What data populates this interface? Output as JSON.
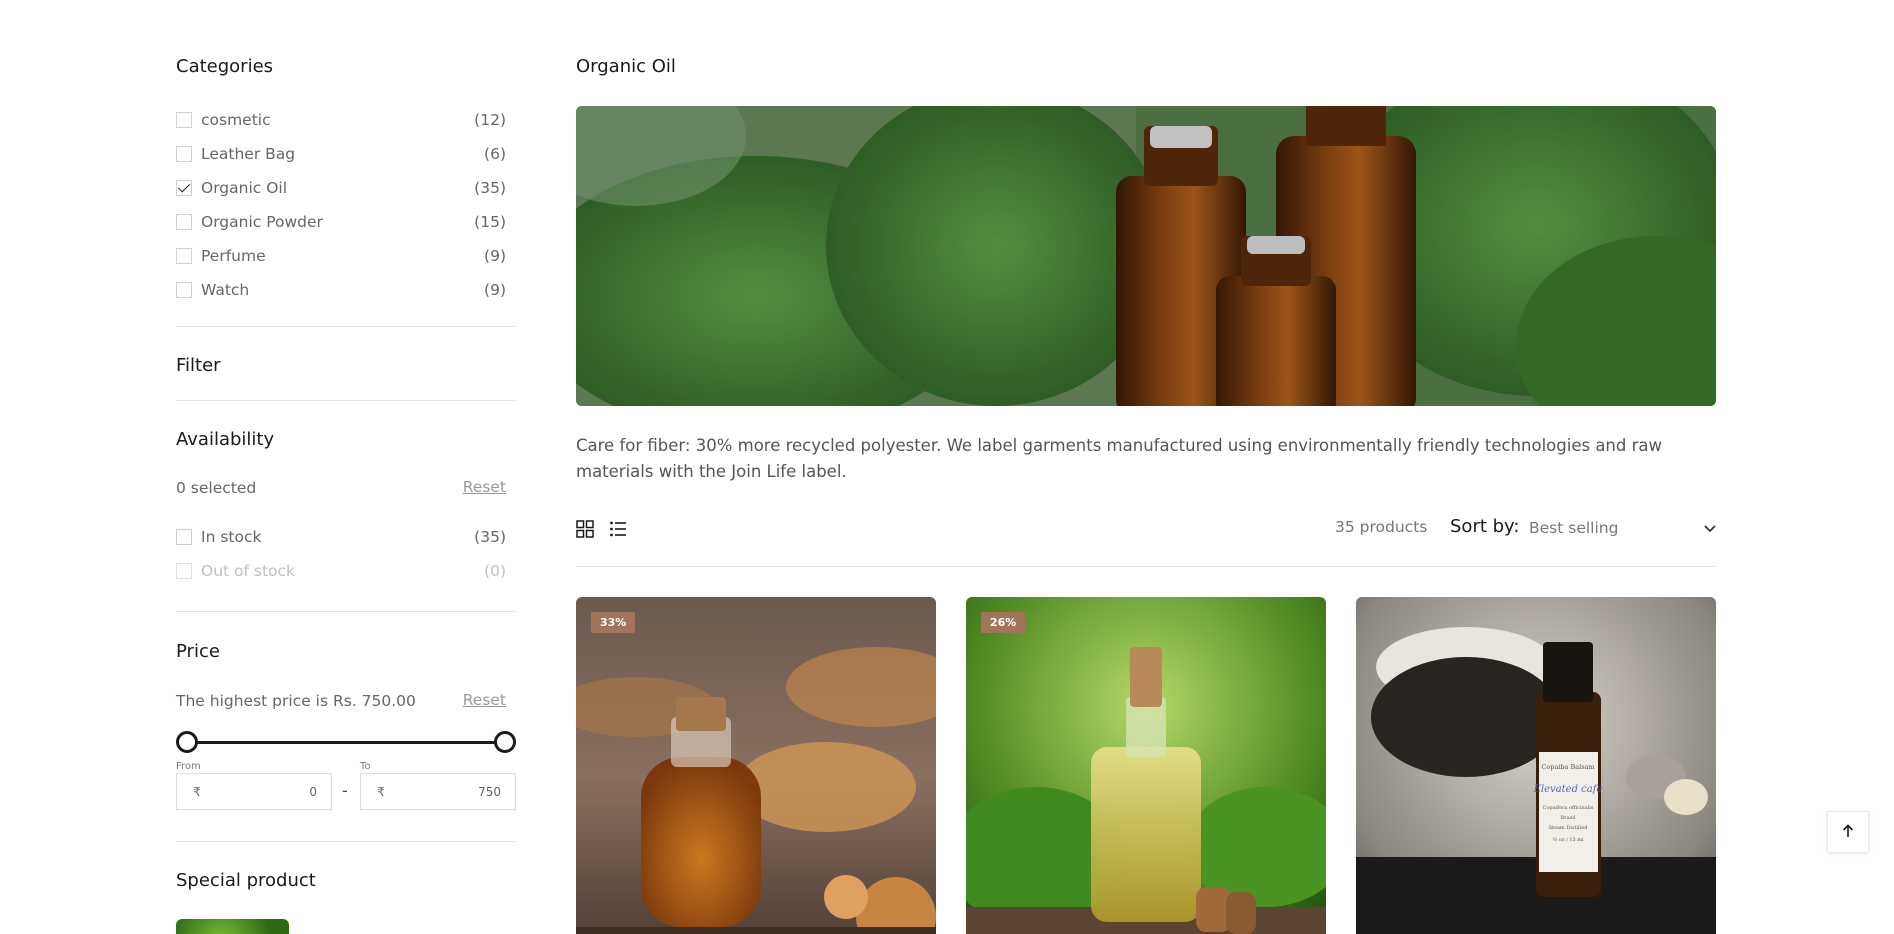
{
  "sidebar": {
    "categories": {
      "heading": "Categories",
      "items": [
        {
          "label": "cosmetic",
          "count": "(12)",
          "checked": false
        },
        {
          "label": "Leather Bag",
          "count": "(6)",
          "checked": false
        },
        {
          "label": "Organic Oil",
          "count": "(35)",
          "checked": true
        },
        {
          "label": "Organic Powder",
          "count": "(15)",
          "checked": false
        },
        {
          "label": "Perfume",
          "count": "(9)",
          "checked": false
        },
        {
          "label": "Watch",
          "count": "(9)",
          "checked": false
        }
      ]
    },
    "filter_heading": "Filter",
    "availability": {
      "heading": "Availability",
      "selected_text": "0 selected",
      "reset_label": "Reset",
      "options": [
        {
          "label": "In stock",
          "count": "(35)"
        },
        {
          "label": "Out of stock",
          "count": "(0)"
        }
      ]
    },
    "price": {
      "heading": "Price",
      "highest_text": "The highest price is Rs. 750.00",
      "reset_label": "Reset",
      "from_label": "From",
      "to_label": "To",
      "currency_symbol": "₹",
      "from_value": "0",
      "to_value": "750",
      "separator": "-",
      "range_min_fraction": 0,
      "range_max_fraction": 1
    },
    "special_heading": "Special product"
  },
  "main": {
    "title": "Organic Oil",
    "description": "Care for fiber: 30% more recycled polyester. We label garments manufactured using environmentally friendly technologies and raw materials with the Join Life label.",
    "product_count": "35 products",
    "sort_label": "Sort by:",
    "sort_value": "Best selling",
    "products": [
      {
        "badge": "33%"
      },
      {
        "badge": "26%"
      },
      {
        "badge": "",
        "label_line1": "Copaiba Balsam",
        "label_script": "Elevated cafe",
        "label_line2": "Copaifera officinalis",
        "label_line3": "Brazil",
        "label_line4": "Steam Distilled",
        "label_line5": "½ oz / 15 ml"
      }
    ]
  },
  "icons": {
    "grid_view": "grid-view-icon",
    "list_view": "list-view-icon",
    "chevron": "chevron-down-icon",
    "back_to_top": "arrow-up-icon"
  },
  "colors": {
    "badge": "#a2745a",
    "text": "#1a1a1a",
    "muted": "#666666"
  }
}
